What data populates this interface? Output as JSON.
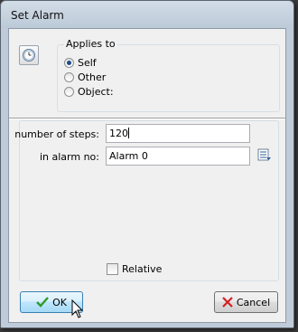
{
  "window": {
    "title": "Set Alarm"
  },
  "applies_to": {
    "label": "Applies to",
    "options": [
      "Self",
      "Other",
      "Object:"
    ],
    "selected": "Self"
  },
  "fields": {
    "steps_label": "number of steps:",
    "steps_value": "120",
    "alarm_label": "in alarm no:",
    "alarm_value": "Alarm 0"
  },
  "relative": {
    "label": "Relative",
    "checked": false
  },
  "buttons": {
    "ok": "OK",
    "cancel": "Cancel"
  },
  "icons": {
    "action": "alarm-clock-icon",
    "ok": "green-checkmark-icon",
    "cancel": "red-x-icon",
    "menu": "list-menu-icon"
  },
  "colors": {
    "ok_check": "#2e9a2e",
    "cancel_x": "#d42020"
  }
}
